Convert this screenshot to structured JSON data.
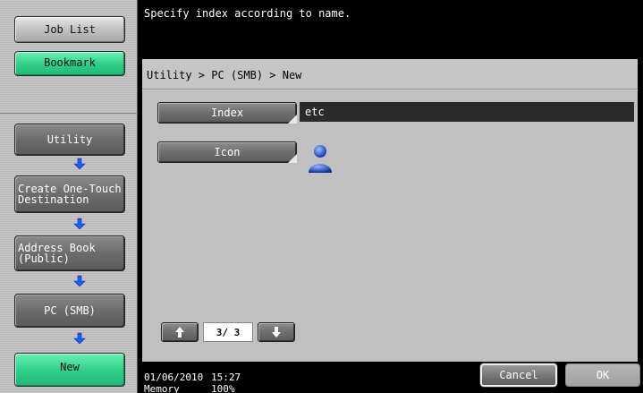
{
  "sidebar": {
    "job_list": "Job List",
    "bookmark": "Bookmark",
    "flow": [
      {
        "label": "Utility"
      },
      {
        "label": "Create One-Touch\nDestination"
      },
      {
        "label": "Address Book\n(Public)"
      },
      {
        "label": "PC (SMB)"
      },
      {
        "label": "New"
      }
    ]
  },
  "message": "Specify index according to name.",
  "breadcrumb": "Utility > PC (SMB) > New",
  "form": {
    "index_label": "Index",
    "index_value": "etc",
    "icon_label": "Icon",
    "icon_name": "person-icon"
  },
  "pager": {
    "display": "3/ 3",
    "up_icon": "arrow-up-icon",
    "down_icon": "arrow-down-icon"
  },
  "status": {
    "date": "01/06/2010",
    "time": "15:27",
    "memory_label": "Memory",
    "memory_value": "100%"
  },
  "buttons": {
    "cancel": "Cancel",
    "ok": "OK"
  },
  "colors": {
    "accent_green": "#32d08a",
    "flow_arrow_blue": "#1a5cff",
    "panel_gray": "#c6c6c6"
  }
}
